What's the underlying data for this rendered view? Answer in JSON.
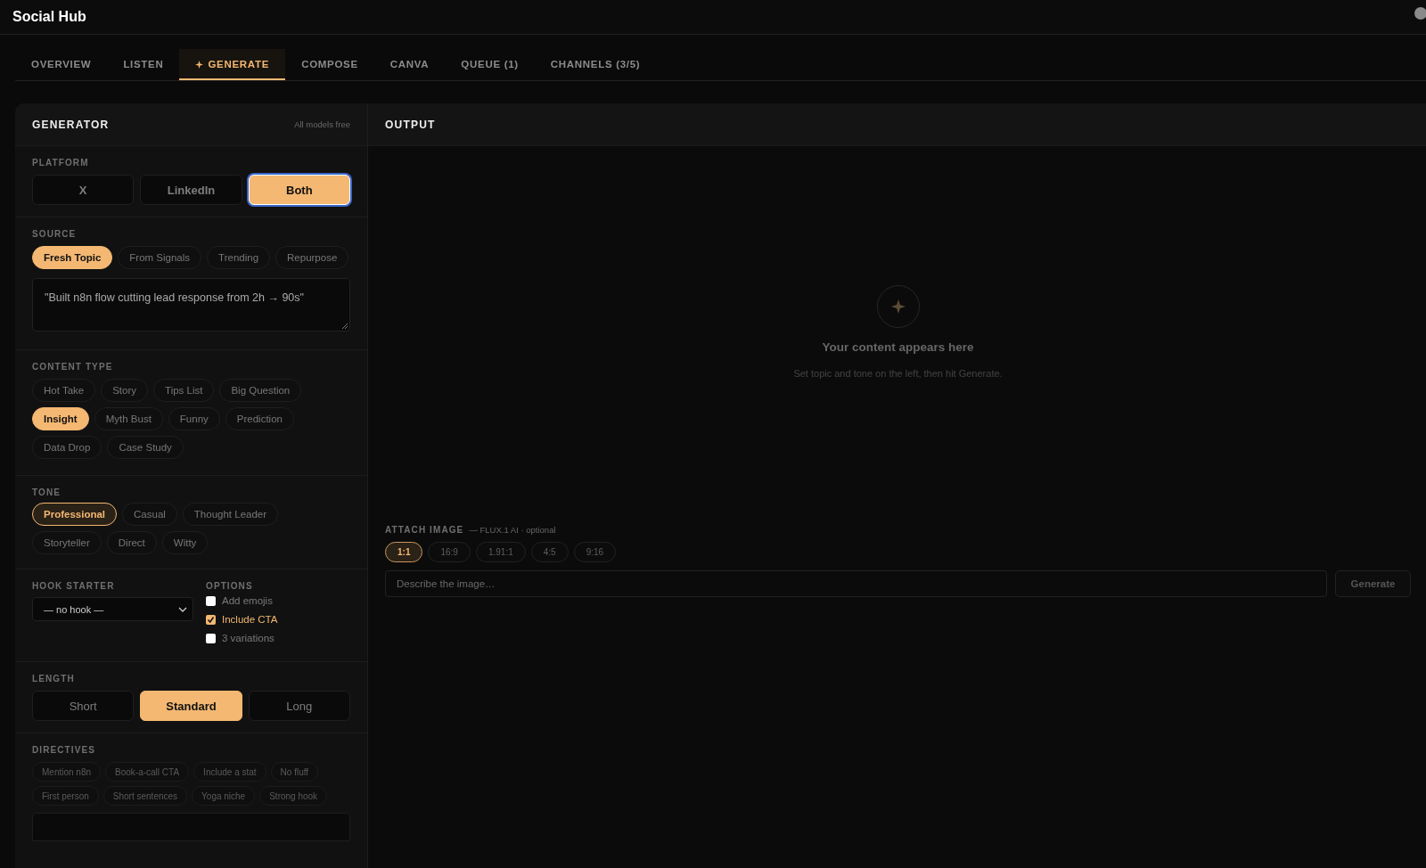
{
  "app": {
    "title": "Social Hub"
  },
  "tabs": [
    {
      "label": "OVERVIEW",
      "selected": false,
      "icon": false
    },
    {
      "label": "LISTEN",
      "selected": false,
      "icon": false
    },
    {
      "label": "GENERATE",
      "selected": true,
      "icon": true
    },
    {
      "label": "COMPOSE",
      "selected": false,
      "icon": false
    },
    {
      "label": "CANVA",
      "selected": false,
      "icon": false
    },
    {
      "label": "QUEUE (1)",
      "selected": false,
      "icon": false
    },
    {
      "label": "CHANNELS (3/5)",
      "selected": false,
      "icon": false
    }
  ],
  "generator": {
    "title": "GENERATOR",
    "note": "All models free",
    "platform": {
      "label": "PLATFORM",
      "options": [
        {
          "label": "X",
          "selected": false,
          "focused": false
        },
        {
          "label": "LinkedIn",
          "selected": false,
          "focused": false
        },
        {
          "label": "Both",
          "selected": true,
          "focused": true
        }
      ]
    },
    "source": {
      "label": "SOURCE",
      "options": [
        {
          "label": "Fresh Topic",
          "selected": true
        },
        {
          "label": "From Signals",
          "selected": false
        },
        {
          "label": "Trending",
          "selected": false
        },
        {
          "label": "Repurpose",
          "selected": false
        }
      ],
      "topic": "\"Built n8n flow cutting lead response from 2h → 90s\""
    },
    "content_type": {
      "label": "CONTENT TYPE",
      "options": [
        {
          "label": "Hot Take",
          "selected": false
        },
        {
          "label": "Story",
          "selected": false
        },
        {
          "label": "Tips List",
          "selected": false
        },
        {
          "label": "Big Question",
          "selected": false
        },
        {
          "label": "Insight",
          "selected": true
        },
        {
          "label": "Myth Bust",
          "selected": false
        },
        {
          "label": "Funny",
          "selected": false
        },
        {
          "label": "Prediction",
          "selected": false
        },
        {
          "label": "Data Drop",
          "selected": false
        },
        {
          "label": "Case Study",
          "selected": false
        }
      ]
    },
    "tone": {
      "label": "TONE",
      "options": [
        {
          "label": "Professional",
          "selected": true
        },
        {
          "label": "Casual",
          "selected": false
        },
        {
          "label": "Thought Leader",
          "selected": false
        },
        {
          "label": "Storyteller",
          "selected": false
        },
        {
          "label": "Direct",
          "selected": false
        },
        {
          "label": "Witty",
          "selected": false
        }
      ]
    },
    "hook_starter": {
      "label": "HOOK STARTER",
      "value": "— no hook —"
    },
    "options": {
      "label": "OPTIONS",
      "items": [
        {
          "label": "Add emojis",
          "checked": false
        },
        {
          "label": "Include CTA",
          "checked": true
        },
        {
          "label": "3 variations",
          "checked": false
        }
      ]
    },
    "length": {
      "label": "LENGTH",
      "options": [
        {
          "label": "Short",
          "selected": false
        },
        {
          "label": "Standard",
          "selected": true
        },
        {
          "label": "Long",
          "selected": false
        }
      ]
    },
    "directives": {
      "label": "DIRECTIVES",
      "options": [
        "Mention n8n",
        "Book-a-call CTA",
        "Include a stat",
        "No fluff",
        "First person",
        "Short sentences",
        "Yoga niche",
        "Strong hook"
      ]
    }
  },
  "output": {
    "title": "OUTPUT",
    "empty_state": {
      "heading": "Your content appears here",
      "text": "Set topic and tone on the left, then hit Generate."
    },
    "attach_image": {
      "label": "ATTACH IMAGE",
      "note": "— FLUX.1 AI · optional",
      "ratios": [
        {
          "label": "1:1",
          "selected": true
        },
        {
          "label": "16:9",
          "selected": false
        },
        {
          "label": "1.91:1",
          "selected": false
        },
        {
          "label": "4:5",
          "selected": false
        },
        {
          "label": "9:16",
          "selected": false
        }
      ],
      "placeholder": "Describe the image…",
      "button": "Generate"
    }
  }
}
